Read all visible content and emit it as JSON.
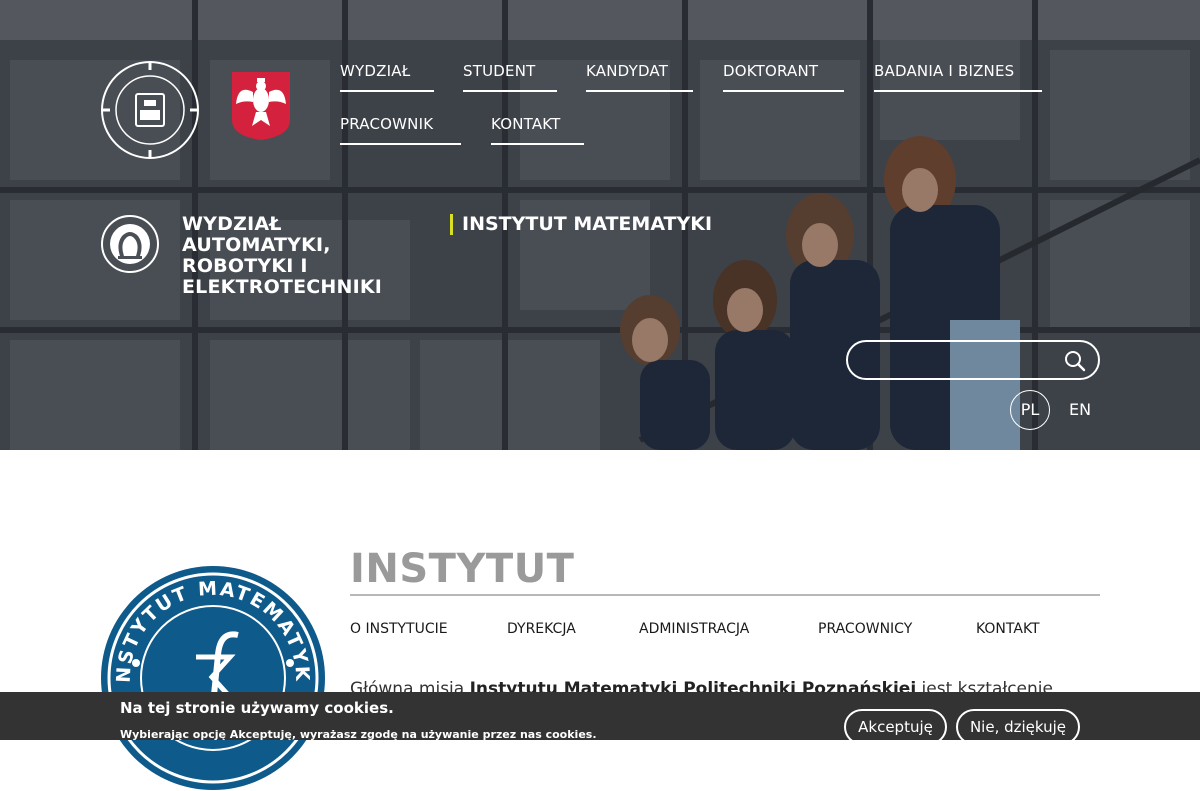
{
  "header": {
    "university_logo_icon": "politechnika-poznanska-seal-icon",
    "national_emblem_icon": "polish-eagle-icon",
    "nav": [
      {
        "label": "WYDZIAŁ"
      },
      {
        "label": "STUDENT"
      },
      {
        "label": "KANDYDAT"
      },
      {
        "label": "DOKTORANT"
      },
      {
        "label": "BADANIA I BIZNES"
      },
      {
        "label": "PRACOWNIK"
      },
      {
        "label": "KONTAKT"
      }
    ],
    "faculty_name": "WYDZIAŁ AUTOMATYKI, ROBOTYKI I ELEKTROTECHNIKI",
    "institute_name": "INSTYTUT MATEMATYKI",
    "search": {
      "placeholder": "",
      "value": "",
      "icon": "search-icon"
    },
    "languages": [
      {
        "code": "PL",
        "active": true
      },
      {
        "code": "EN",
        "active": false
      }
    ],
    "accent_color": "#d9e021"
  },
  "main": {
    "logo_text": "INSTYTUT MATEMATYKI",
    "title": "INSTYTUT",
    "subnav": [
      {
        "label": "O INSTYTUCIE"
      },
      {
        "label": "DYREKCJA"
      },
      {
        "label": "ADMINISTRACJA"
      },
      {
        "label": "PRACOWNICY"
      },
      {
        "label": "KONTAKT"
      }
    ],
    "intro": {
      "prefix": "Główna misja ",
      "bold": "Instytutu Matematyki Politechniki Poznańskiej",
      "suffix": " jest kształcenie"
    },
    "logo_color": "#0e5a8a"
  },
  "cookie_bar": {
    "title": "Na tej stronie używamy cookies.",
    "text": "Wybierając opcję Akceptuję, wyrażasz zgodę na używanie przez nas cookies.",
    "accept_label": "Akceptuję",
    "decline_label": "Nie, dziękuję"
  }
}
